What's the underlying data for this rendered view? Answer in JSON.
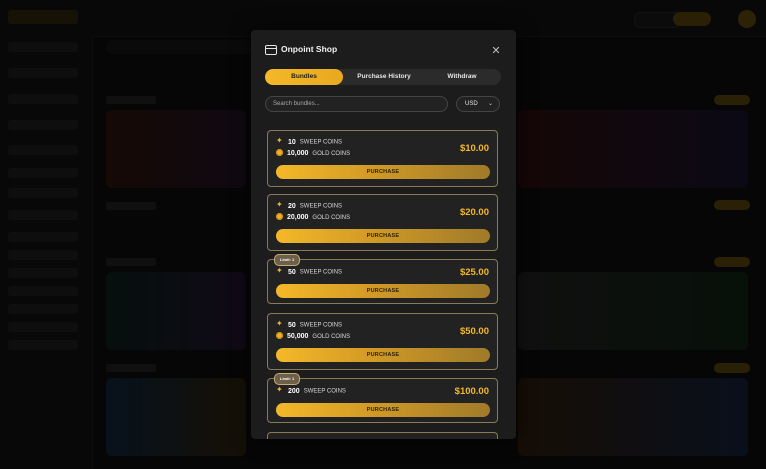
{
  "modal": {
    "title": "Onpoint Shop",
    "close_icon": "close-icon",
    "tabs": [
      {
        "label": "Bundles",
        "active": true
      },
      {
        "label": "Purchase History",
        "active": false
      },
      {
        "label": "Withdraw",
        "active": false
      }
    ],
    "search": {
      "placeholder": "Search bundles..."
    },
    "currency": {
      "value": "USD"
    },
    "accent_color": "#f4b829",
    "bundles": [
      {
        "sweep_amount": "10",
        "sweep_label": "SWEEP COINS",
        "gold_amount": "10,000",
        "gold_label": "GOLD COINS",
        "price": "$10.00",
        "button": "PURCHASE",
        "limit": ""
      },
      {
        "sweep_amount": "20",
        "sweep_label": "SWEEP COINS",
        "gold_amount": "20,000",
        "gold_label": "GOLD COINS",
        "price": "$20.00",
        "button": "PURCHASE",
        "limit": ""
      },
      {
        "sweep_amount": "50",
        "sweep_label": "SWEEP COINS",
        "gold_amount": "",
        "gold_label": "",
        "price": "$25.00",
        "button": "PURCHASE",
        "limit": "Limit: 1"
      },
      {
        "sweep_amount": "50",
        "sweep_label": "SWEEP COINS",
        "gold_amount": "50,000",
        "gold_label": "GOLD COINS",
        "price": "$50.00",
        "button": "PURCHASE",
        "limit": ""
      },
      {
        "sweep_amount": "200",
        "sweep_label": "SWEEP COINS",
        "gold_amount": "",
        "gold_label": "",
        "price": "$100.00",
        "button": "PURCHASE",
        "limit": "Limit: 1"
      }
    ]
  }
}
